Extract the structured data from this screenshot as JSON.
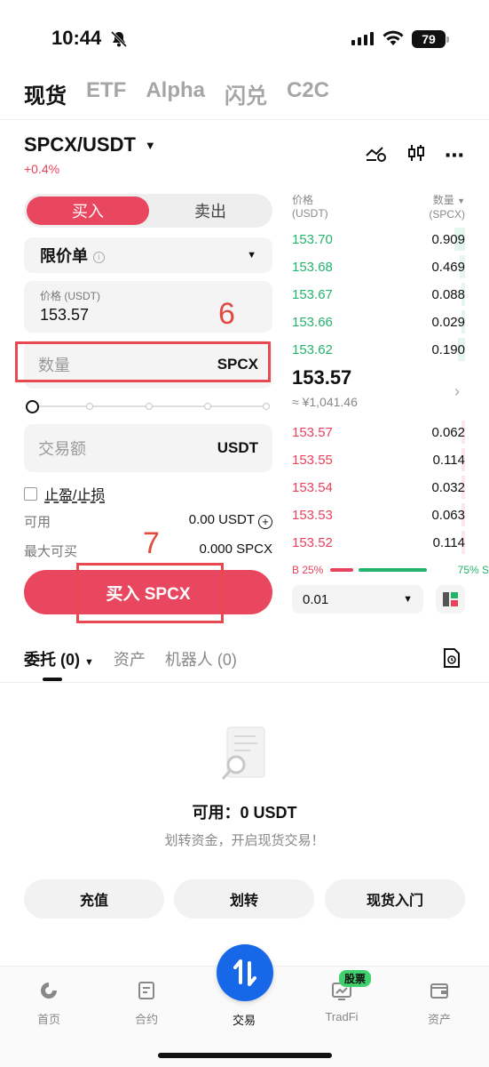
{
  "status_bar": {
    "time": "10:44",
    "battery": "79"
  },
  "top_tabs": [
    {
      "label": "现货",
      "active": true
    },
    {
      "label": "ETF",
      "active": false
    },
    {
      "label": "Alpha",
      "active": false
    },
    {
      "label": "闪兑",
      "active": false
    },
    {
      "label": "C2C",
      "active": false
    }
  ],
  "pair": {
    "name": "SPCX/USDT",
    "change": "+0.4%"
  },
  "order_form": {
    "buy_label": "买入",
    "sell_label": "卖出",
    "order_type": "限价单",
    "price_label": "价格 (USDT)",
    "price_value": "153.57",
    "qty_placeholder": "数量",
    "qty_unit": "SPCX",
    "amount_placeholder": "交易额",
    "amount_unit": "USDT",
    "tpsl_label": "止盈/止损",
    "available_label": "可用",
    "available_value": "0.00 USDT",
    "max_buy_label": "最大可买",
    "max_buy_value": "0.000 SPCX",
    "submit_label": "买入 SPCX"
  },
  "annotations": {
    "step6": "6",
    "step7": "7"
  },
  "orderbook": {
    "price_header": "价格",
    "price_unit": "(USDT)",
    "qty_header": "数量",
    "qty_unit": "(SPCX)",
    "asks": [
      {
        "price": "153.70",
        "qty": "0.909",
        "depth": 0.06
      },
      {
        "price": "153.68",
        "qty": "0.469",
        "depth": 0.03
      },
      {
        "price": "153.67",
        "qty": "0.088",
        "depth": 0.02
      },
      {
        "price": "153.66",
        "qty": "0.029",
        "depth": 0.02
      },
      {
        "price": "153.62",
        "qty": "0.190",
        "depth": 0.04
      }
    ],
    "mid_price": "153.57",
    "mid_cny": "≈ ¥1,041.46",
    "bids": [
      {
        "price": "153.57",
        "qty": "0.062",
        "depth": 0.02
      },
      {
        "price": "153.55",
        "qty": "0.114",
        "depth": 0.02
      },
      {
        "price": "153.54",
        "qty": "0.032",
        "depth": 0.02
      },
      {
        "price": "153.53",
        "qty": "0.063",
        "depth": 0.02
      },
      {
        "price": "153.52",
        "qty": "0.114",
        "depth": 0.02
      }
    ],
    "buy_ratio_label": "B 25%",
    "sell_ratio_label": "75% S",
    "buy_ratio": 0.25,
    "precision": "0.01"
  },
  "order_tabs": [
    {
      "label": "委托 (0)",
      "active": true
    },
    {
      "label": "资产",
      "active": false
    },
    {
      "label": "机器人 (0)",
      "active": false
    }
  ],
  "empty_state": {
    "available": "可用：0 USDT",
    "hint": "划转资金，开启现货交易！"
  },
  "actions": [
    "充值",
    "划转",
    "现货入门"
  ],
  "bottom_nav": [
    {
      "label": "首页",
      "icon": "home-icon"
    },
    {
      "label": "合约",
      "icon": "contract-icon"
    },
    {
      "label": "交易",
      "icon": "trade-icon"
    },
    {
      "label": "TradFi",
      "icon": "tradfi-icon",
      "badge": "股票"
    },
    {
      "label": "资产",
      "icon": "wallet-icon"
    }
  ],
  "colors": {
    "buy": "#e94660",
    "ask_green": "#24b36b",
    "bid_red": "#e8425d",
    "trade_blue": "#1768e8",
    "annotation_red": "#e8484f"
  }
}
